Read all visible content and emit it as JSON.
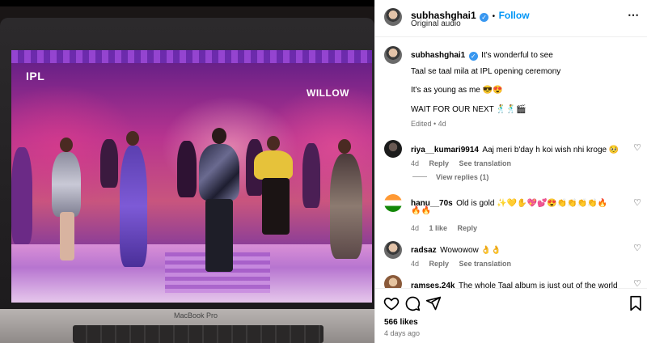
{
  "media": {
    "ipl_logo": "IPL",
    "broadcaster_logo": "WILLOW",
    "laptop_label": "MacBook Pro"
  },
  "post": {
    "author": "subhashghai1",
    "follow_label": "Follow",
    "audio": "Original audio",
    "caption_lines": [
      "It's wonderful to see",
      "Taal se taal mila at IPL opening ceremony",
      "It's as young as me 😎😍",
      "WAIT FOR OUR NEXT 🕺🕺🎬"
    ],
    "edited": "Edited • 4d"
  },
  "comments": [
    {
      "user": "riya__kumari9914",
      "text": "Aaj meri b'day h koi wish nhi kroge 🥺",
      "time": "4d",
      "reply": "Reply",
      "see_translation": "See translation",
      "view_replies": "View replies (1)"
    },
    {
      "user": "hanu__70s",
      "text": "Old is gold ✨💛✋💖💕😍👏👏👏👏🔥",
      "text_line2": "🔥🔥",
      "time": "4d",
      "likes": "1 like",
      "reply": "Reply"
    },
    {
      "user": "radsaz",
      "text": "Wowowow 👌👌",
      "time": "4d",
      "reply": "Reply",
      "see_translation": "See translation"
    },
    {
      "user": "ramses.24k",
      "text": "The whole Taal album is just out of the world"
    }
  ],
  "footer": {
    "likes": "566 likes",
    "time": "4 days ago"
  },
  "icons": {
    "more": "more-options-icon",
    "like": "heart-icon",
    "comment": "comment-icon",
    "share": "share-icon",
    "save": "bookmark-icon"
  }
}
